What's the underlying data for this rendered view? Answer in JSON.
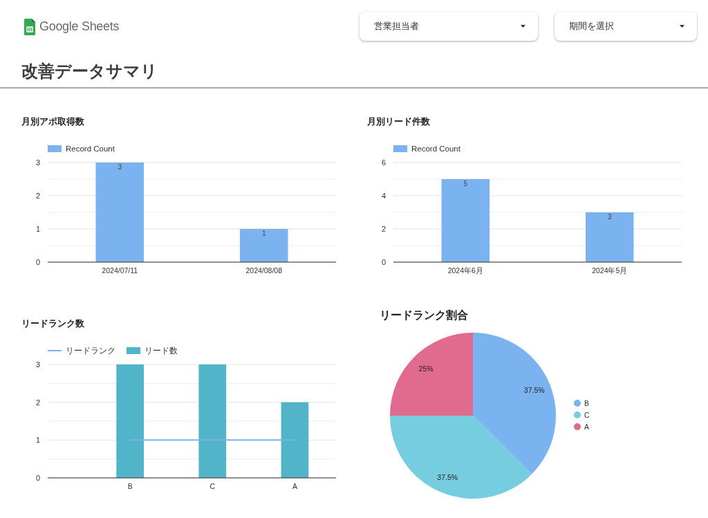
{
  "header": {
    "logo_text": "Google Sheets",
    "filters": [
      {
        "label": "営業担当者"
      },
      {
        "label": "期間を選択"
      }
    ]
  },
  "page_title": "改善データサマリ",
  "panels": [
    {
      "title": "月別アポ取得数",
      "chart_data": {
        "type": "bar",
        "categories": [
          "2024/07/11",
          "2024/08/08"
        ],
        "series": [
          {
            "name": "Record Count",
            "color": "#7ab3ef",
            "type": "bar",
            "values": [
              3,
              1
            ]
          }
        ],
        "legend": "top",
        "ylim": [
          0,
          3
        ],
        "yticks": [
          0,
          1,
          2,
          3
        ],
        "data_labels": true
      }
    },
    {
      "title": "月別リード件数",
      "chart_data": {
        "type": "bar",
        "categories": [
          "2024年6月",
          "2024年5月"
        ],
        "series": [
          {
            "name": "Record Count",
            "color": "#7ab3ef",
            "type": "bar",
            "values": [
              5,
              3
            ]
          }
        ],
        "legend": "top",
        "ylim": [
          0,
          6
        ],
        "yticks": [
          0,
          2,
          4,
          6
        ],
        "data_labels": true
      }
    },
    {
      "title": "リードランク数",
      "chart_data": {
        "type": "bar",
        "categories": [
          "B",
          "C",
          "A"
        ],
        "series": [
          {
            "name": "リードランク",
            "color": "#7ab3ef",
            "type": "line",
            "values": [
              1,
              1,
              1
            ]
          },
          {
            "name": "リード数",
            "color": "#52b4c8",
            "type": "bar",
            "values": [
              3,
              3,
              2
            ]
          }
        ],
        "legend": "top",
        "ylim": [
          0,
          3
        ],
        "yticks": [
          0,
          1,
          2,
          3
        ]
      }
    },
    {
      "title": "リードランク割合",
      "chart_data": {
        "type": "pie",
        "categories": [
          "B",
          "C",
          "A"
        ],
        "legend": "right",
        "series": [
          {
            "values": [
              37.5,
              37.5,
              25
            ],
            "colors": [
              "#7ab3ef",
              "#76cddf",
              "#e06b8e"
            ]
          }
        ],
        "value_labels": [
          "37.5%",
          "37.5%",
          "25%"
        ]
      }
    }
  ]
}
